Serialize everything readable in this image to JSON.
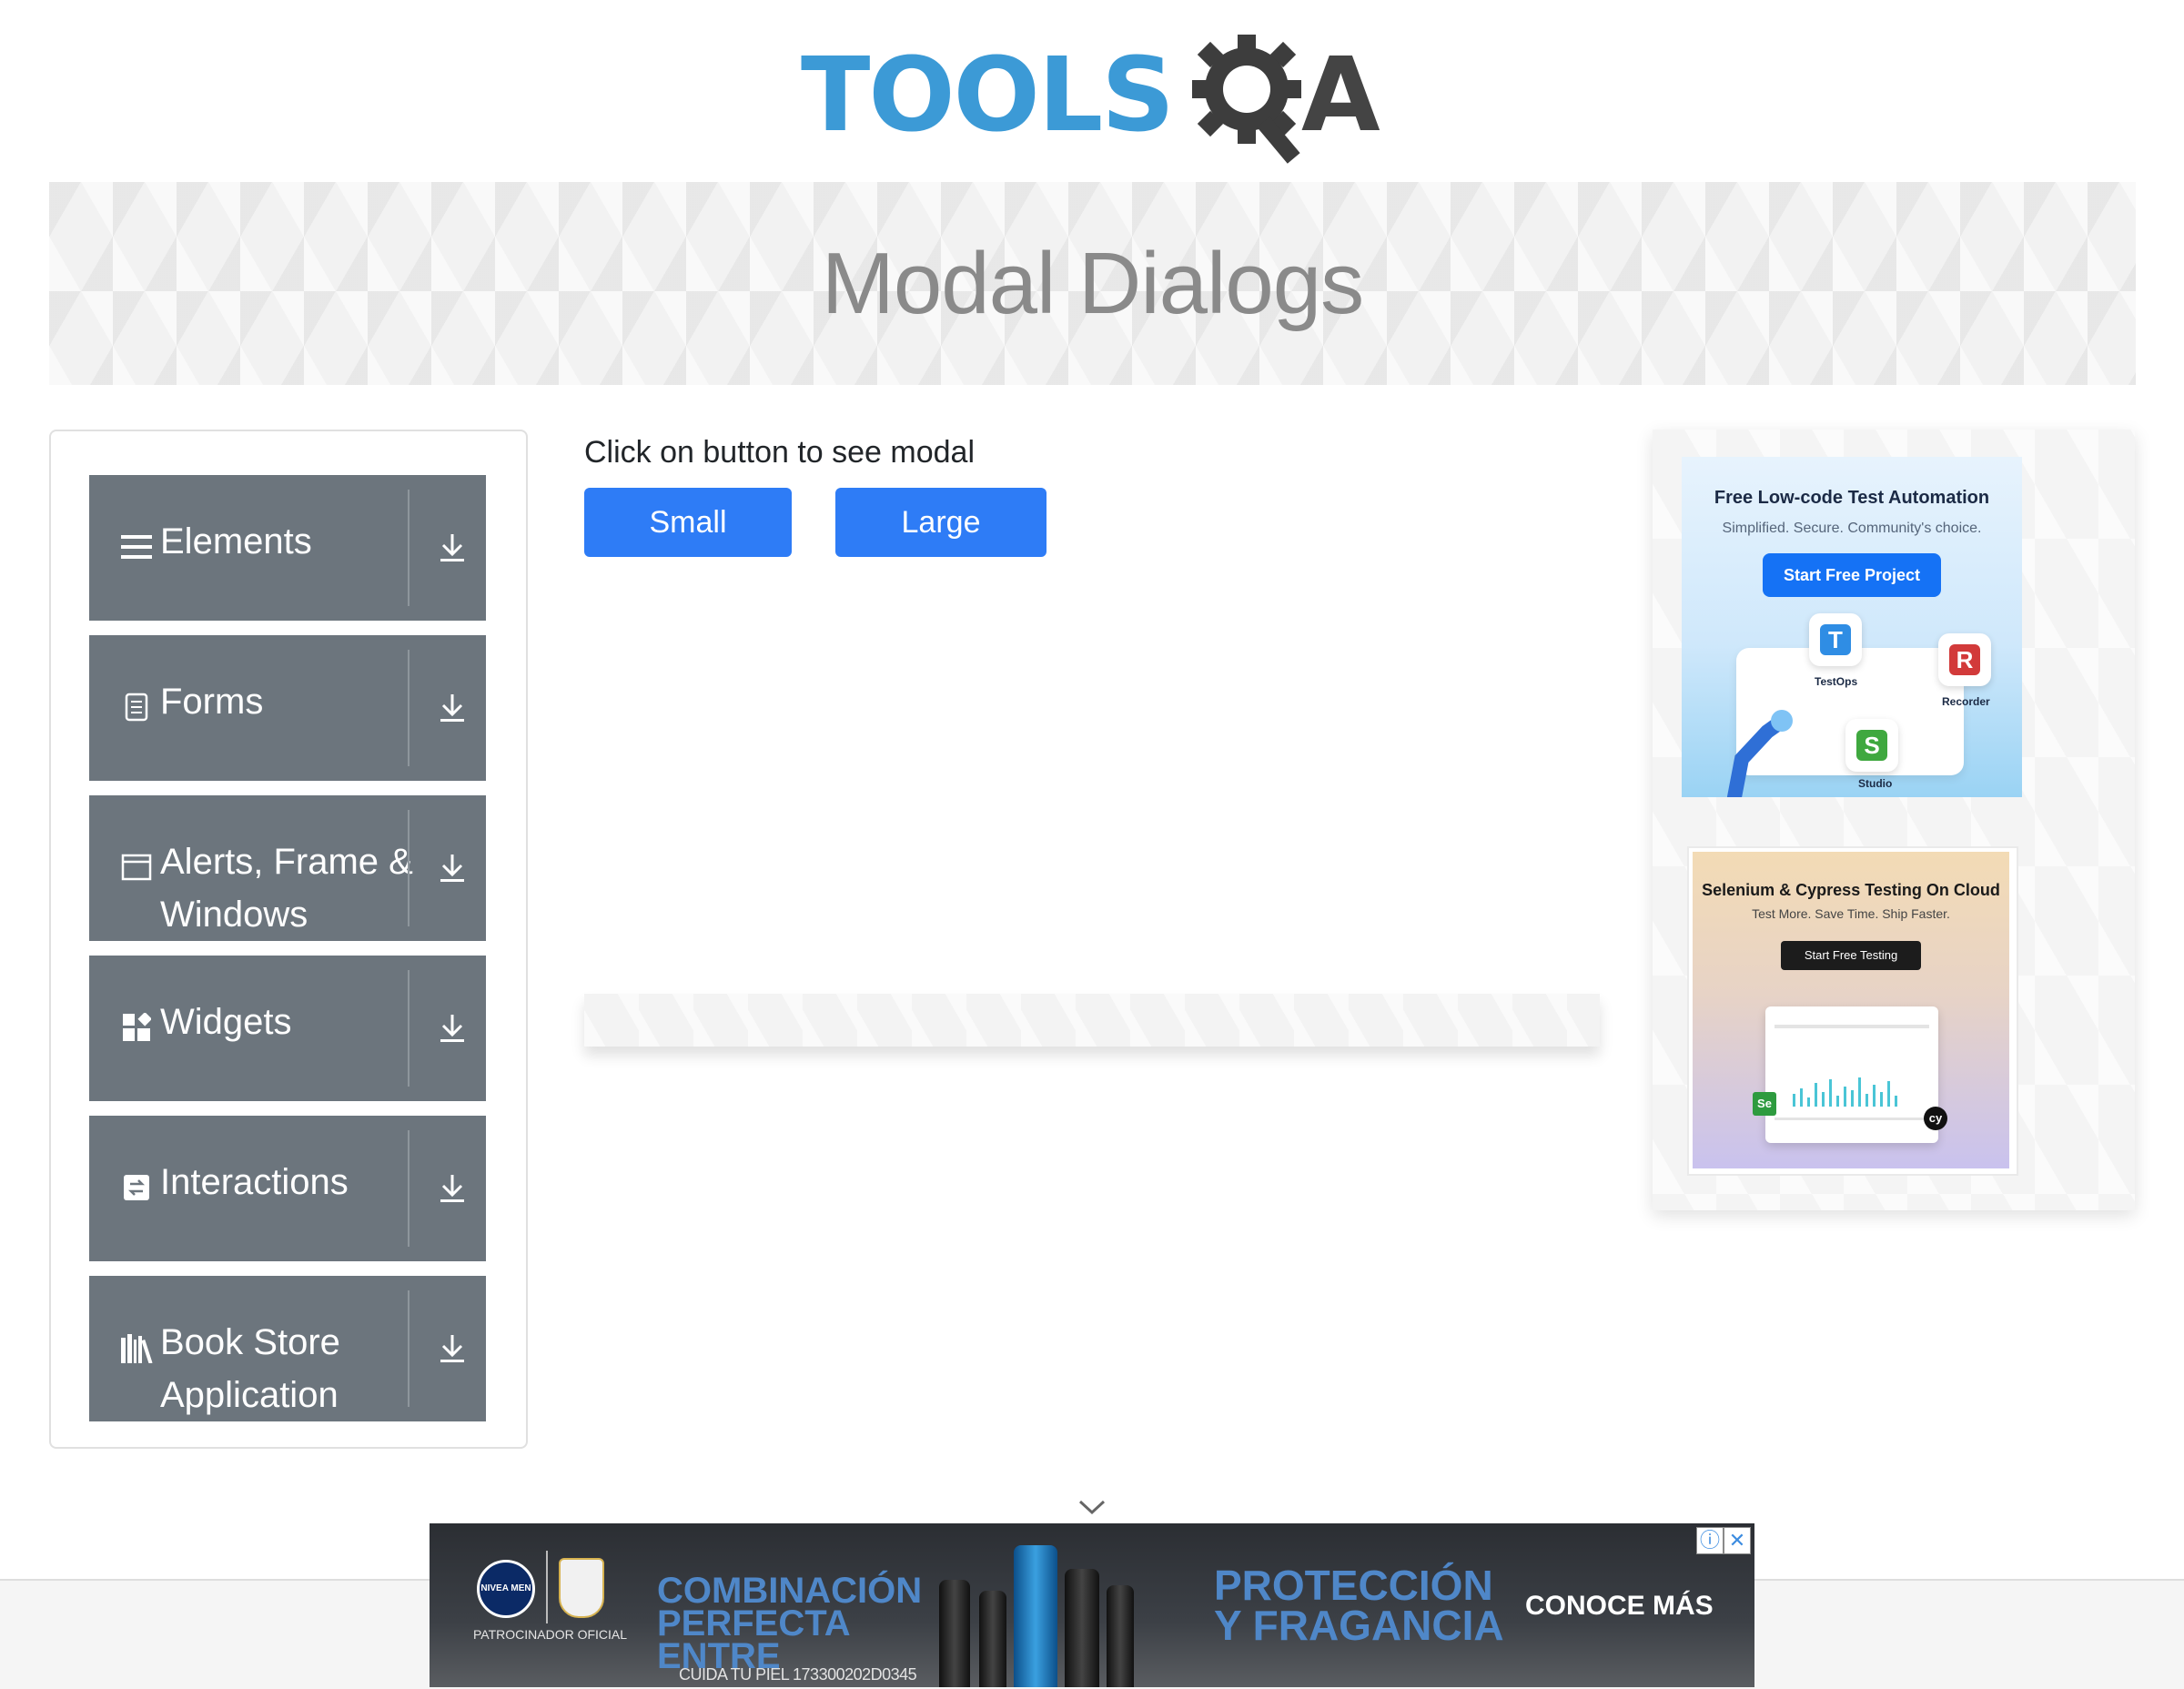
{
  "header": {
    "logo_text": "TOOLS",
    "logo_suffix": "A"
  },
  "banner": {
    "title": "Modal Dialogs"
  },
  "sidebar": {
    "groups": [
      {
        "label": "Elements",
        "icon": "hamburger-icon"
      },
      {
        "label": "Forms",
        "icon": "document-icon"
      },
      {
        "label": "Alerts, Frame & Windows",
        "icon": "window-icon"
      },
      {
        "label": "Widgets",
        "icon": "widgets-icon"
      },
      {
        "label": "Interactions",
        "icon": "interactions-icon"
      },
      {
        "label": "Book Store Application",
        "icon": "books-icon"
      }
    ],
    "expand_icon": "download-arrow-icon"
  },
  "main": {
    "instruction": "Click on button to see modal",
    "small_modal_label": "Small modal",
    "large_modal_label": "Large modal"
  },
  "ads": {
    "katalon": {
      "title": "Free Low-code Test Automation",
      "subtitle": "Simplified. Secure. Community's choice.",
      "cta": "Start Free Project",
      "products": [
        "TestOps",
        "Recorder",
        "Studio"
      ]
    },
    "lambdatest": {
      "title": "Selenium & Cypress Testing On Cloud",
      "subtitle": "Test More. Save Time. Ship Faster.",
      "cta": "Start Free Testing"
    },
    "bottom": {
      "brand": "NIVEA MEN",
      "sponsor": "PATROCINADOR OFICIAL",
      "headline": "COMBINACIÓN PERFECTA ENTRE",
      "headline2": "PROTECCIÓN Y FRAGANCIA",
      "cta": "CONOCE MÁS",
      "code": "CUIDA TU PIEL 173300202D0345",
      "info_icon": "info-icon",
      "close_icon": "close-icon"
    }
  },
  "colors": {
    "accent": "#2e7cf6",
    "sidebar_bg": "#6c757d",
    "logo_blue": "#3c9ad6"
  }
}
